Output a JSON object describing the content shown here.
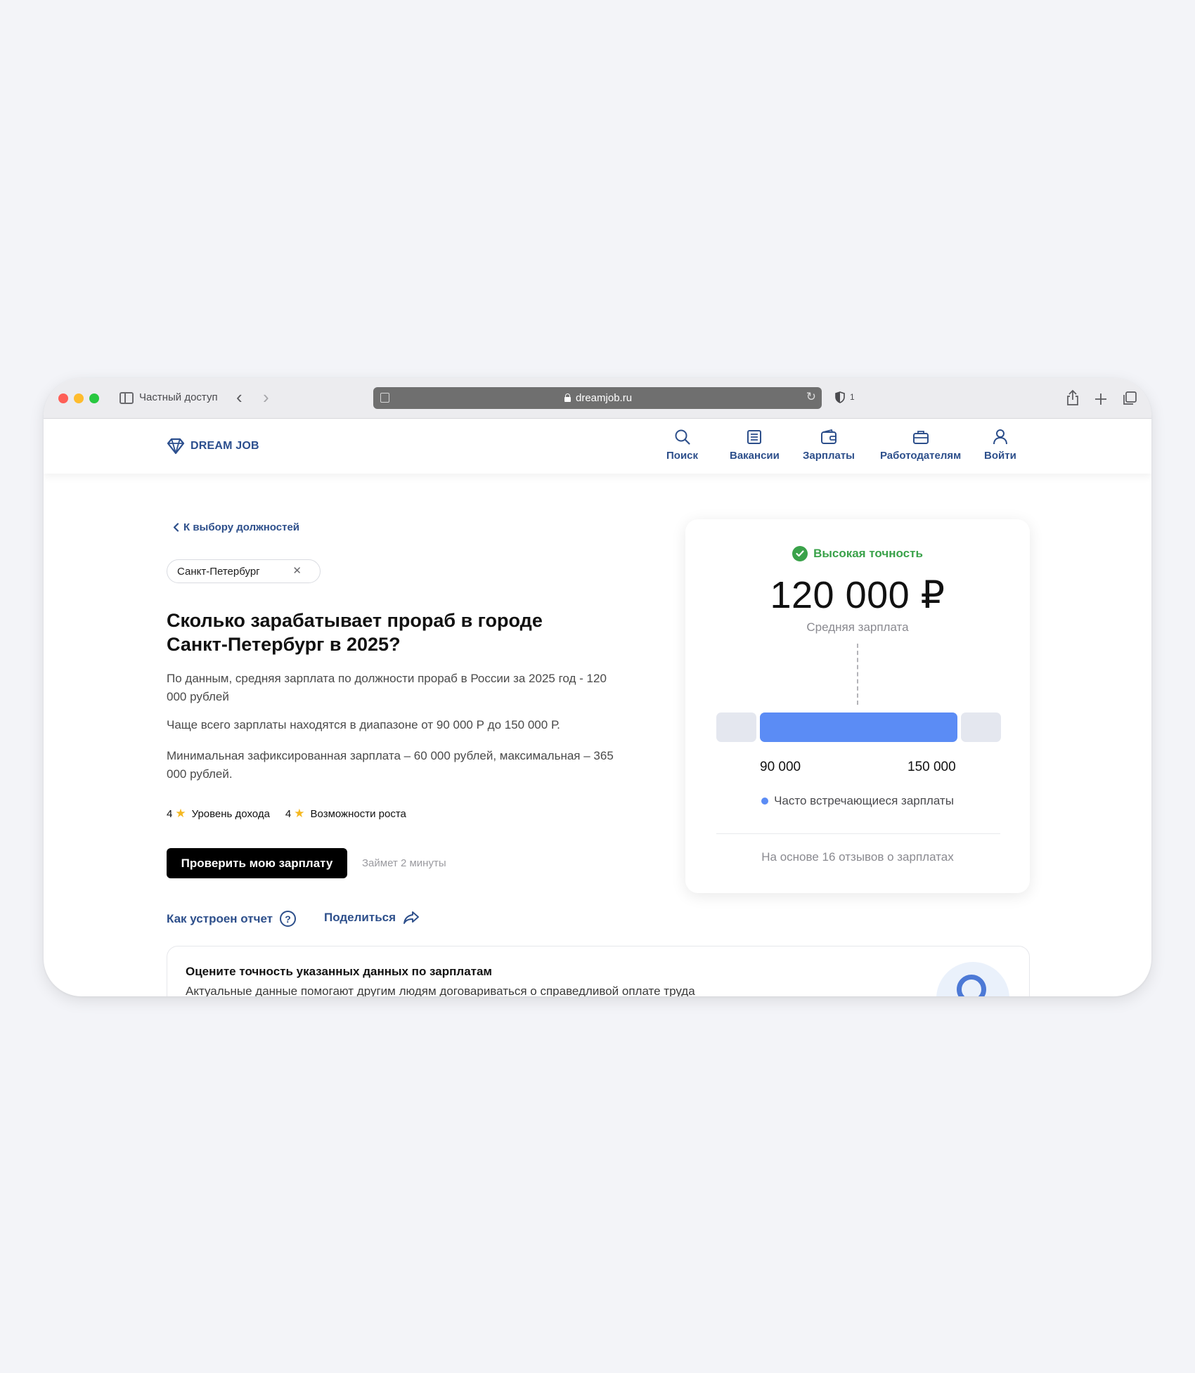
{
  "browser": {
    "private_label": "Частный доступ",
    "url": "dreamjob.ru",
    "shield_count": "1"
  },
  "header": {
    "logo_text": "DREAM JOB",
    "nav": [
      {
        "label": "Поиск",
        "icon": "search-icon"
      },
      {
        "label": "Вакансии",
        "icon": "list-icon"
      },
      {
        "label": "Зарплаты",
        "icon": "wallet-icon"
      },
      {
        "label": "Работодателям",
        "icon": "briefcase-icon"
      },
      {
        "label": "Войти",
        "icon": "user-icon"
      }
    ]
  },
  "main": {
    "back_link": "К выбору должностей",
    "city_chip": "Санкт-Петербург",
    "headline": "Сколько зарабатывает прораб в городе Санкт-Петербург в 2025?",
    "paragraphs": [
      "По данным, средняя зарплата по должности прораб в России за 2025 год - 120 000 рублей",
      "Чаще всего зарплаты находятся в диапазоне от 90 000 Р до 150 000 Р.",
      "Минимальная зафиксированная зарплата – 60 000 рублей, максимальная – 365 000 рублей."
    ],
    "ratings": [
      {
        "value": "4",
        "label": "Уровень дохода"
      },
      {
        "value": "4",
        "label": "Возможности роста"
      }
    ],
    "cta_label": "Проверить мою зарплату",
    "cta_hint": "Займет 2 минуты",
    "help_link": "Как устроен отчет",
    "help_icon": "?",
    "share_link": "Поделиться"
  },
  "salary_card": {
    "accuracy": "Высокая точность",
    "average": "120 000 ₽",
    "average_label": "Средняя зарплата",
    "range_low": "90 000",
    "range_high": "150 000",
    "legend": "Часто встречающиеся зарплаты",
    "reviews": "На основе 16 отзывов о зарплатах"
  },
  "rate_card": {
    "title": "Оцените точность указанных данных по зарплатам",
    "subtitle": "Актуальные данные помогают другим людям договариваться о справедливой оплате труда"
  },
  "colors": {
    "brand": "#2d4f8b",
    "accent_bar": "#5b8cf5",
    "success": "#3aa24a",
    "star": "#f5b820"
  }
}
